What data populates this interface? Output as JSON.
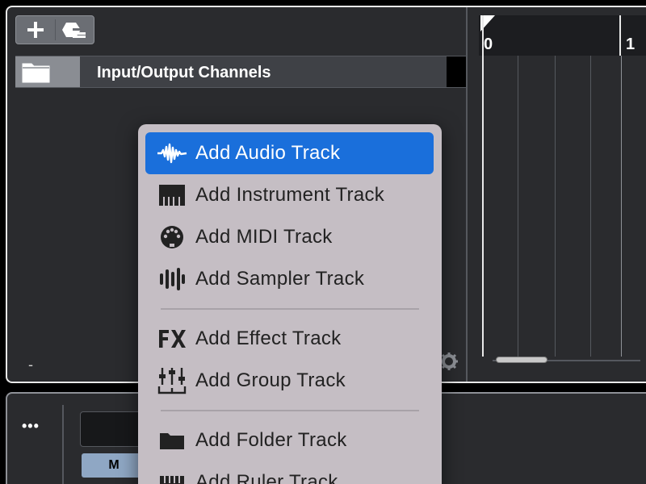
{
  "track_list": {
    "tracks": [
      {
        "name": "Input/Output Channels"
      }
    ],
    "zoom_minus": "-"
  },
  "ruler": {
    "tick_labels": [
      "0",
      "1"
    ]
  },
  "mixer": {
    "more_label": "•••",
    "mute_label": "M"
  },
  "context_menu": {
    "items": [
      {
        "label": "Add Audio Track",
        "icon": "waveform-icon",
        "selected": true
      },
      {
        "label": "Add Instrument Track",
        "icon": "piano-keys-icon",
        "selected": false
      },
      {
        "label": "Add MIDI Track",
        "icon": "midi-connector-icon",
        "selected": false
      },
      {
        "label": "Add Sampler Track",
        "icon": "sampler-icon",
        "selected": false
      },
      {
        "label": "Add Effect Track",
        "icon": "fx-icon",
        "selected": false
      },
      {
        "label": "Add Group Track",
        "icon": "group-faders-icon",
        "selected": false
      },
      {
        "label": "Add Folder Track",
        "icon": "folder-icon",
        "selected": false
      },
      {
        "label": "Add Ruler Track",
        "icon": "ruler-icon",
        "selected": false
      }
    ]
  },
  "colors": {
    "selection": "#1a6fdb",
    "menu_background": "#c5bec4",
    "panel_background": "#2a2b2e"
  }
}
